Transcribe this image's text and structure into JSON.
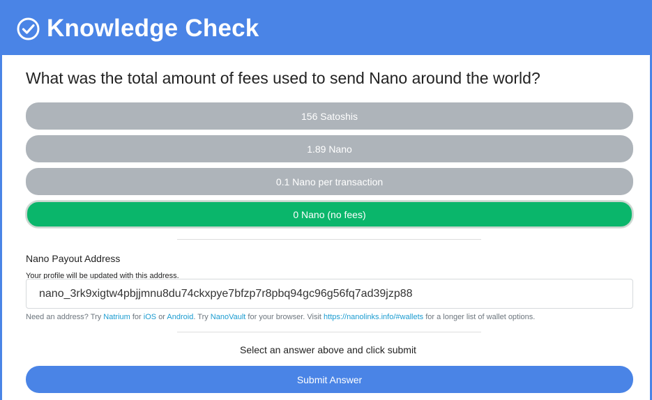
{
  "header": {
    "title": "Knowledge Check",
    "icon": "check-circle-icon"
  },
  "question": "What was the total amount of fees used to send Nano around the world?",
  "options": [
    {
      "label": "156 Satoshis",
      "selected": false
    },
    {
      "label": "1.89 Nano",
      "selected": false
    },
    {
      "label": "0.1 Nano per transaction",
      "selected": false
    },
    {
      "label": "0 Nano (no fees)",
      "selected": true
    }
  ],
  "payout": {
    "label": "Nano Payout Address",
    "note": "Your profile will be updated with this address.",
    "value": "nano_3rk9xigtw4pbjjmnu8du74ckxpye7bfzp7r8pbq94gc96g56fq7ad39jzp88"
  },
  "help": {
    "prefix": "Need an address? Try",
    "natrium": "Natrium",
    "for": "for",
    "ios": "iOS",
    "or": "or",
    "android": "Android",
    "try": ". Try",
    "nanovault": "NanoVault",
    "browser": "for your browser. Visit",
    "link": "https://nanolinks.info/#wallets",
    "suffix": "for a longer list of wallet options."
  },
  "status": "Select an answer above and click submit",
  "submit_label": "Submit Answer",
  "colors": {
    "accent": "#4a84e6",
    "option_default": "#aeb4ba",
    "option_selected": "#0ab66b",
    "link": "#1a9bd0"
  }
}
